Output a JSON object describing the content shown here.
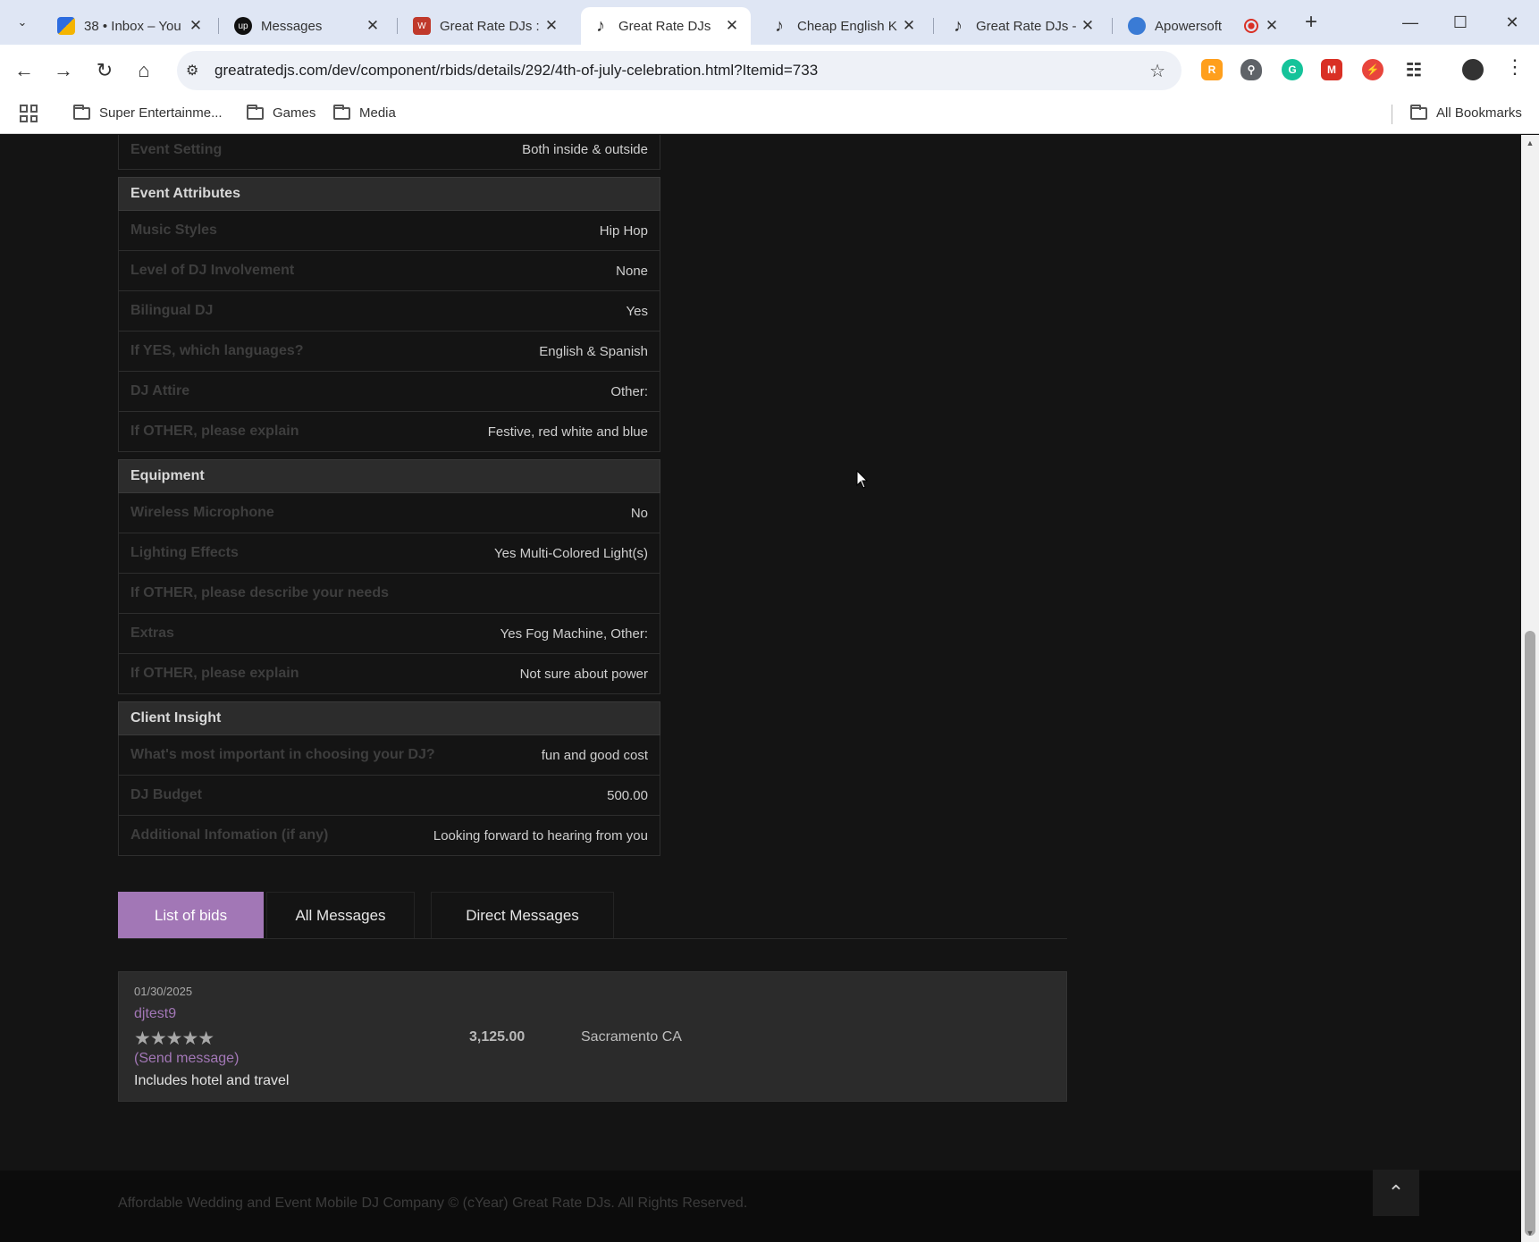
{
  "browser": {
    "tabs": [
      {
        "title": "38 • Inbox – You",
        "icon": "yahoo-mail-icon"
      },
      {
        "title": "Messages",
        "icon": "upwork-icon"
      },
      {
        "title": "Great Rate DJs :",
        "icon": "grd-site-icon"
      },
      {
        "title": "Great Rate DJs",
        "icon": "dj-note-icon"
      },
      {
        "title": "Cheap English K",
        "icon": "dj-note-icon"
      },
      {
        "title": "Great Rate DJs -",
        "icon": "dj-note-icon"
      },
      {
        "title": "Apowersoft",
        "icon": "apowersoft-icon"
      }
    ],
    "url": "greatratedjs.com/dev/component/rbids/details/292/4th-of-july-celebration.html?Itemid=733",
    "bookmarks": [
      "Super Entertainme...",
      "Games",
      "Media"
    ],
    "all_bookmarks": "All Bookmarks"
  },
  "details": {
    "top_row": {
      "label": "Event Setting",
      "value": "Both inside & outside"
    },
    "sections": [
      {
        "title": "Event Attributes",
        "rows": [
          {
            "label": "Music Styles",
            "value": "Hip Hop"
          },
          {
            "label": "Level of DJ Involvement",
            "value": "None"
          },
          {
            "label": "Bilingual DJ",
            "value": "Yes"
          },
          {
            "label": "If YES, which languages?",
            "value": "English & Spanish"
          },
          {
            "label": "DJ Attire",
            "value": "Other:"
          },
          {
            "label": "If OTHER, please explain",
            "value": "Festive, red white and blue"
          }
        ]
      },
      {
        "title": "Equipment",
        "rows": [
          {
            "label": "Wireless Microphone",
            "value": "No"
          },
          {
            "label": "Lighting Effects",
            "value": "Yes Multi-Colored Light(s)"
          },
          {
            "label": "If OTHER, please describe your needs",
            "value": ""
          },
          {
            "label": "Extras",
            "value": "Yes Fog Machine, Other:"
          },
          {
            "label": "If OTHER, please explain",
            "value": "Not sure about power"
          }
        ]
      },
      {
        "title": "Client Insight",
        "rows": [
          {
            "label": "What's most important in choosing your DJ?",
            "value": "fun and good cost"
          },
          {
            "label": "DJ Budget",
            "value": "500.00"
          },
          {
            "label": "Additional Infomation (if any)",
            "value": "Looking forward to hearing from you"
          }
        ]
      }
    ]
  },
  "tabs_nav": {
    "list_of_bids": "List of bids",
    "all_messages": "All Messages",
    "direct_messages": "Direct Messages",
    "active": "List of bids"
  },
  "bid": {
    "date": "01/30/2025",
    "user": "djtest9",
    "stars": "★★★★★",
    "rating": 5,
    "send_message": "(Send message)",
    "note": "Includes hotel and travel",
    "amount": "3,125.00",
    "location": "Sacramento CA"
  },
  "footer": {
    "text": "Affordable Wedding and Event Mobile DJ Company © (cYear) Great Rate DJs. All Rights Reserved."
  },
  "colors": {
    "accent": "#a277b6",
    "page_bg": "#141414",
    "section_bg": "#2c2c2c"
  }
}
